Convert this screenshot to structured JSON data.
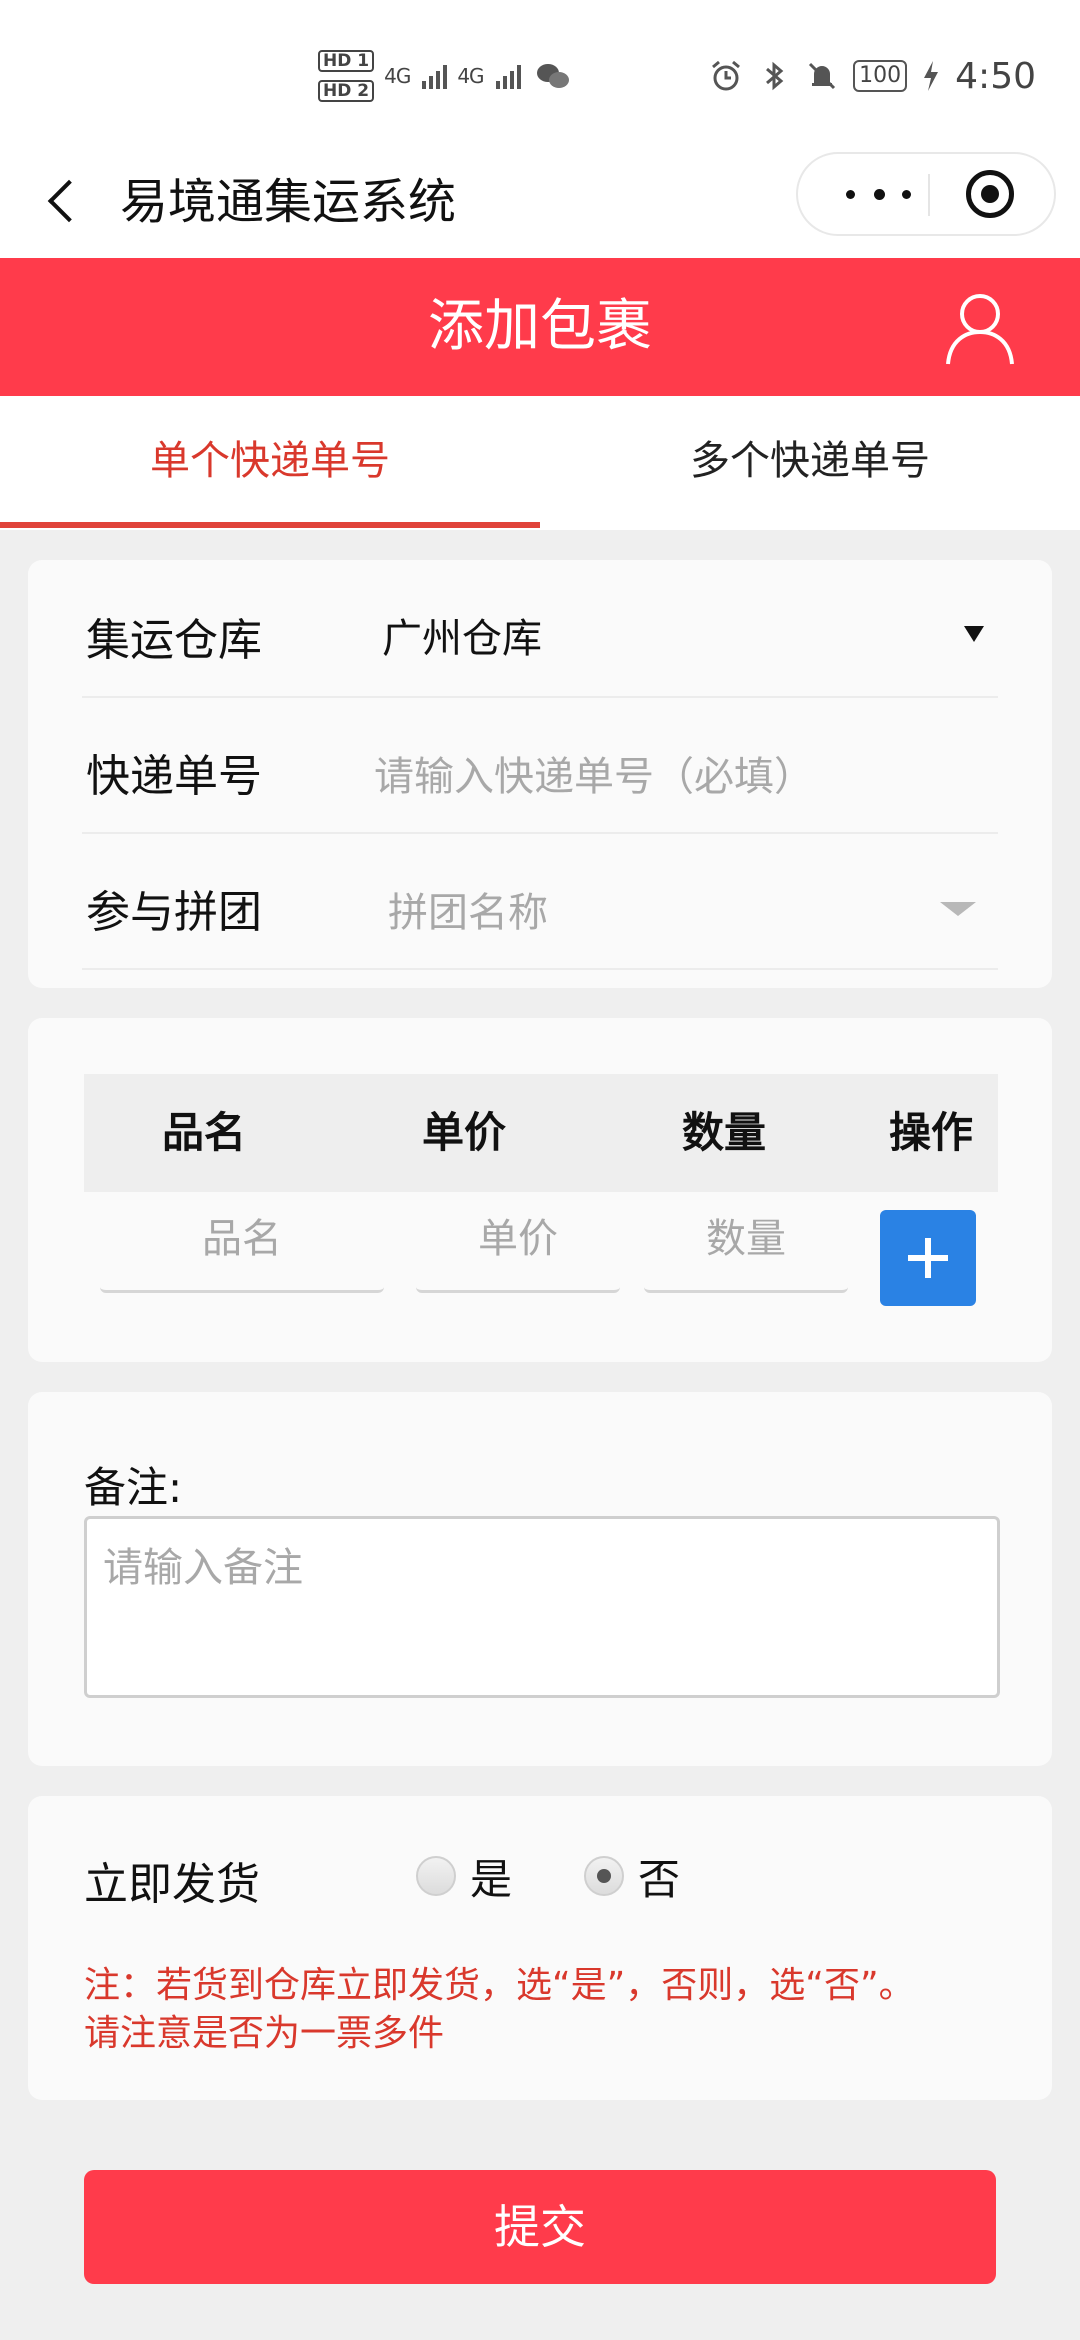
{
  "status_bar": {
    "sim1": "HD 1",
    "sim2": "HD 2",
    "net1": "4G",
    "net2": "4G",
    "battery": "100",
    "time": "4:50"
  },
  "title_bar": {
    "title": "易境通集运系统",
    "icons": [
      "back-icon",
      "more-icon",
      "close-icon"
    ]
  },
  "header": {
    "title": "添加包裹",
    "icon": "user-icon",
    "color": "#ff3b4b"
  },
  "tabs": [
    {
      "label": "单个快递单号",
      "active": true
    },
    {
      "label": "多个快递单号",
      "active": false
    }
  ],
  "form": {
    "warehouse_label": "集运仓库",
    "warehouse_value": "广州仓库",
    "tracking_label": "快递单号",
    "tracking_placeholder": "请输入快递单号（必填）",
    "group_label": "参与拼团",
    "group_placeholder": "拼团名称"
  },
  "items_table": {
    "headers": [
      "品名",
      "单价",
      "数量",
      "操作"
    ],
    "placeholders": {
      "name": "品名",
      "price": "单价",
      "qty": "数量"
    }
  },
  "remark": {
    "label": "备注:",
    "placeholder": "请输入备注"
  },
  "ship_now": {
    "label": "立即发货",
    "options": [
      {
        "label": "是",
        "selected": false
      },
      {
        "label": "否",
        "selected": true
      }
    ],
    "note_line1": "注：若货到仓库立即发货，选“是”，否则，选“否”。",
    "note_line2": "请注意是否为一票多件"
  },
  "submit_label": "提交",
  "colors": {
    "accent_red": "#ff3b4b",
    "tab_red": "#d9382c",
    "add_blue": "#2a82e4"
  }
}
